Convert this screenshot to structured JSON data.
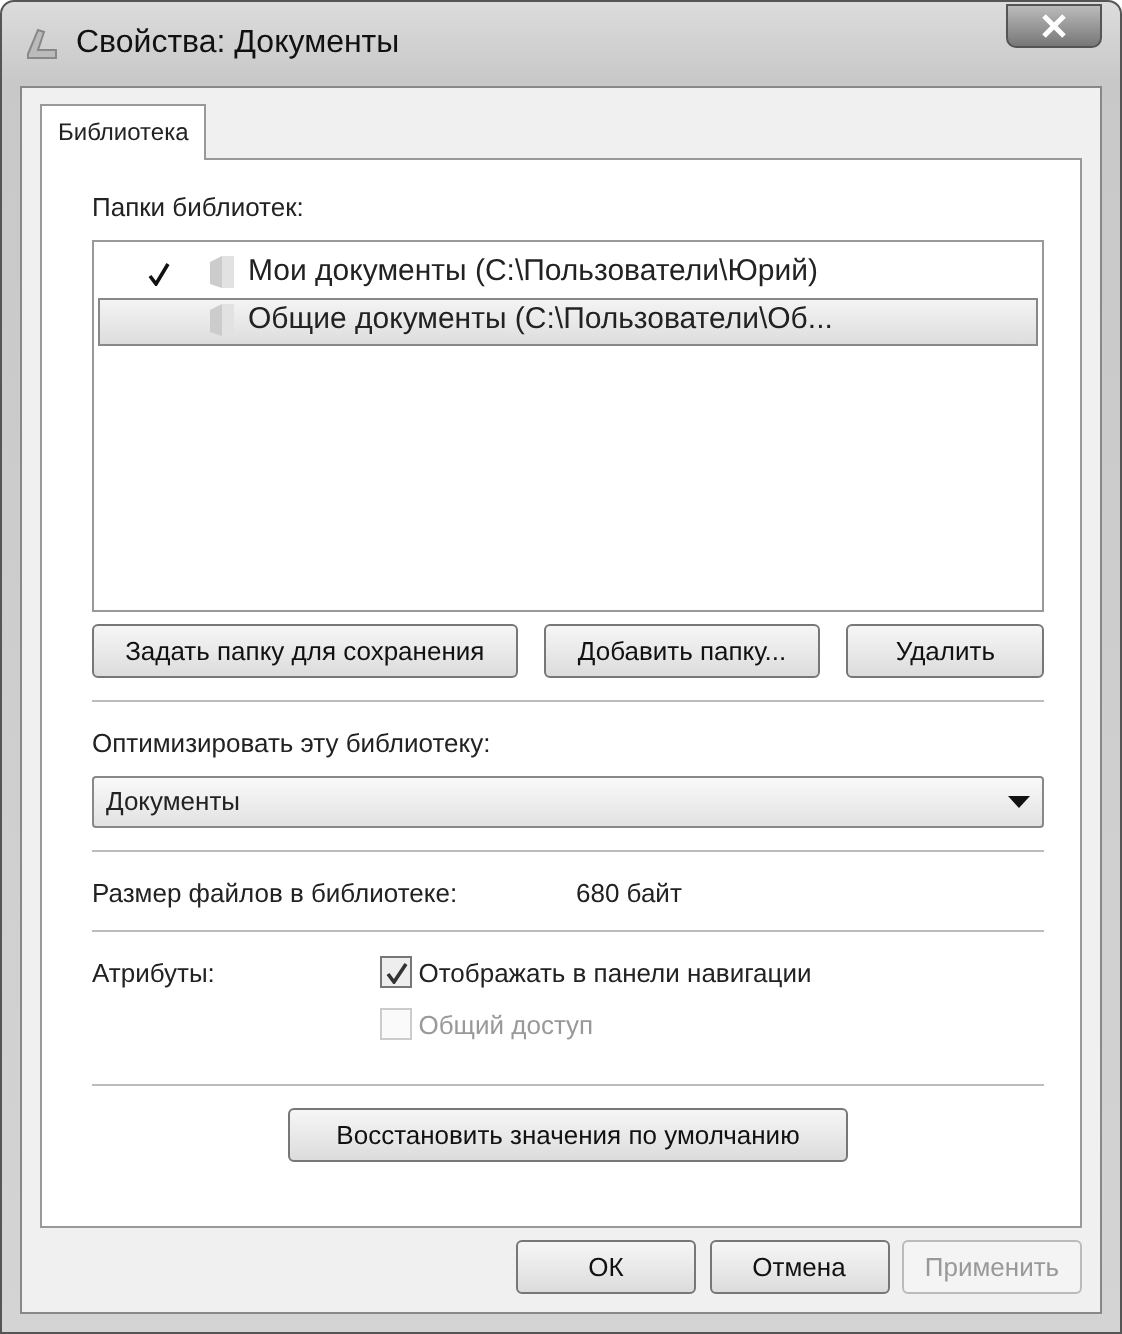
{
  "window": {
    "title": "Свойства: Документы"
  },
  "tabs": [
    {
      "label": "Библиотека",
      "selected": true
    }
  ],
  "folders_label": "Папки библиотек:",
  "folders": [
    {
      "name": "Мои документы (C:\\Пользователи\\Юрий)",
      "default": true,
      "selected": false
    },
    {
      "name": "Общие документы (C:\\Пользователи\\Об...",
      "default": false,
      "selected": true
    }
  ],
  "folder_buttons": [
    "Задать папку для сохранения",
    "Добавить папку...",
    "Удалить"
  ],
  "optimize": {
    "label": "Оптимизировать эту библиотеку:",
    "value": "Документы"
  },
  "size": {
    "label": "Размер файлов в библиотеке:",
    "value": "680 байт"
  },
  "attributes": {
    "label": "Атрибуты:",
    "options": [
      {
        "label": "Отображать в панели навигации",
        "checked": true,
        "disabled": false
      },
      {
        "label": "Общий доступ",
        "checked": false,
        "disabled": true
      }
    ]
  },
  "restore_button": "Восстановить значения по умолчанию",
  "dialog_buttons": [
    {
      "label": "ОК",
      "disabled": false
    },
    {
      "label": "Отмена",
      "disabled": false
    },
    {
      "label": "Применить",
      "disabled": true
    }
  ]
}
